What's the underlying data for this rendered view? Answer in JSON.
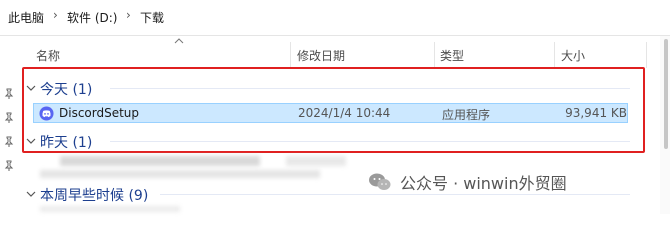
{
  "breadcrumb": {
    "items": [
      "此电脑",
      "软件 (D:)",
      "下载"
    ],
    "separator": "›"
  },
  "columns": {
    "name": "名称",
    "modified": "修改日期",
    "type": "类型",
    "size": "大小"
  },
  "groups": [
    {
      "label": "今天 (1)"
    },
    {
      "label": "昨天 (1)"
    },
    {
      "label": "本周早些时候 (9)"
    }
  ],
  "files": [
    {
      "name": "DiscordSetup",
      "modified": "2024/1/4 10:44",
      "type": "应用程序",
      "size": "93,941 KB",
      "icon": "discord-icon"
    }
  ],
  "watermark": {
    "text": "公众号 · winwin外贸圈",
    "icon": "wechat-icon"
  },
  "colors": {
    "highlight": "#e02020",
    "selection": "#cce8ff",
    "group_text": "#1d3f8f"
  }
}
